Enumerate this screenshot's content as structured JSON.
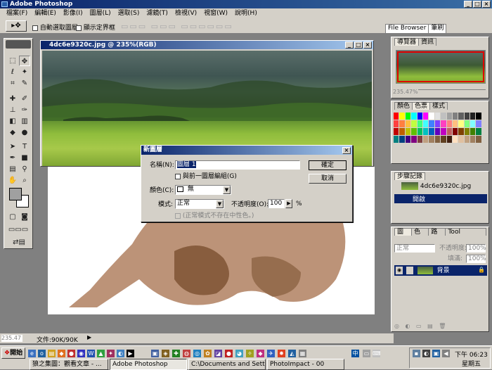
{
  "app": {
    "title": "Adobe Photoshop"
  },
  "menu": [
    "檔案(F)",
    "編輯(E)",
    "影像(I)",
    "圖層(L)",
    "選取(S)",
    "濾鏡(T)",
    "檢視(V)",
    "視窗(W)",
    "說明(H)"
  ],
  "options": {
    "auto_select": "自動選取圖層",
    "show_bounds": "顯示定界框"
  },
  "palette_well": {
    "file_browser": "File Browser",
    "brushes": "筆刷"
  },
  "document": {
    "title": "4dc6e9320c.jpg @ 235%(RGB)"
  },
  "dialog": {
    "title": "新圖層",
    "name_label": "名稱(N):",
    "name_value": "圖層 1",
    "group_label": "與前一圖層編組(G)",
    "color_label": "顏色(C):",
    "color_value": "無",
    "mode_label": "模式:",
    "mode_value": "正常",
    "opacity_label": "不透明度(O):",
    "opacity_value": "100",
    "opacity_unit": "%",
    "neutral_label": "(正常模式不存在中性色。)",
    "ok": "確定",
    "cancel": "取消"
  },
  "navigator": {
    "tab1": "導覽器",
    "tab2": "資訊",
    "zoom": "235.47%"
  },
  "color_panel": {
    "tab1": "顏色",
    "tab2": "色票",
    "tab3": "樣式"
  },
  "history": {
    "tab": "步驟記錄",
    "snapshot": "4dc6e9320c.jpg",
    "item": "開啟"
  },
  "layers": {
    "tab1": "圖層",
    "tab2": "色版",
    "tab3": "路徑",
    "tab4": "Tool Presets",
    "mode": "正常",
    "opacity_label": "不透明度:",
    "opacity_value": "100%",
    "fill_label": "填滿:",
    "fill_value": "100%",
    "layer_name": "背景"
  },
  "status": {
    "zoom": "235.47",
    "doc": "文件:90K/90K"
  },
  "taskbar": {
    "start": "開始",
    "tasks": [
      "狼之集圖：觀看文章 - ...",
      "Adobe Photoshop",
      "C:\\Documents and Setting...",
      "PhotoImpact - 00"
    ],
    "time": "下午 06:23",
    "day": "星期五"
  },
  "colors": {
    "title": "#0a246a",
    "face": "#d4d0c8",
    "selection": "#0a246a"
  },
  "swatches": [
    "#ff0000",
    "#ffff00",
    "#00ff00",
    "#00ffff",
    "#0000ff",
    "#ff00ff",
    "#ffffff",
    "#e0e0e0",
    "#c0c0c0",
    "#a0a0a0",
    "#808080",
    "#606060",
    "#404040",
    "#202020",
    "#000000",
    "#ff4040",
    "#ff8040",
    "#ffc040",
    "#c0ff40",
    "#40ff80",
    "#40ffff",
    "#4080ff",
    "#8040ff",
    "#ff40c0",
    "#ff8080",
    "#ffc080",
    "#ffff80",
    "#80ff80",
    "#80ffff",
    "#8080ff",
    "#c00000",
    "#c06000",
    "#c0c000",
    "#60c000",
    "#00c060",
    "#00c0c0",
    "#0060c0",
    "#6000c0",
    "#c000c0",
    "#c06060",
    "#800000",
    "#804000",
    "#808000",
    "#408000",
    "#008040",
    "#008080",
    "#004080",
    "#400080",
    "#800080",
    "#804040",
    "#c0a080",
    "#a08060",
    "#806040",
    "#604020",
    "#402010",
    "#ffe0c0",
    "#e0c0a0",
    "#c0a080",
    "#a08060",
    "#806040"
  ]
}
